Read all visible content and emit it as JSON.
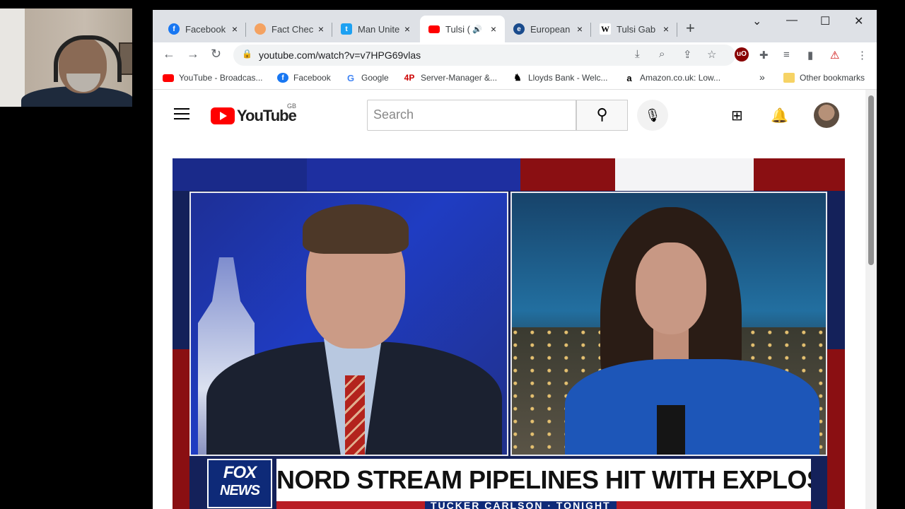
{
  "tabs": [
    {
      "title": "Facebook",
      "close": "×"
    },
    {
      "title": "Fact Chec",
      "close": "×"
    },
    {
      "title": "Man Unite",
      "close": "×"
    },
    {
      "title": "Tulsi (",
      "close": "×"
    },
    {
      "title": "European",
      "close": "×"
    },
    {
      "title": "Tulsi Gab",
      "close": "×"
    }
  ],
  "new_tab": "+",
  "window": {
    "minimize": "—",
    "maximize": "☐",
    "close": "✕",
    "tab_search": "⌄"
  },
  "address": {
    "url": "youtube.com/watch?v=v7HPG69vlas"
  },
  "bookmarks": [
    {
      "label": "YouTube - Broadcas..."
    },
    {
      "label": "Facebook"
    },
    {
      "label": "Google"
    },
    {
      "label": "Server-Manager &..."
    },
    {
      "label": "Lloyds Bank - Welc..."
    },
    {
      "label": "Amazon.co.uk: Low..."
    }
  ],
  "bookmarks_more": "»",
  "other_bookmarks": "Other bookmarks",
  "youtube": {
    "logo_text": "YouTube",
    "country": "GB",
    "search_placeholder": "Search"
  },
  "video": {
    "headline": "NORD STREAM PIPELINES HIT WITH EXPLOSIVES",
    "network_top": "FOX",
    "network_bottom": "NEWS",
    "show": "TUCKER CARLSON · TONIGHT"
  },
  "colors": {
    "youtube_red": "#ff0000",
    "fox_blue": "#0e2a78",
    "tab_strip": "#dee1e6"
  }
}
